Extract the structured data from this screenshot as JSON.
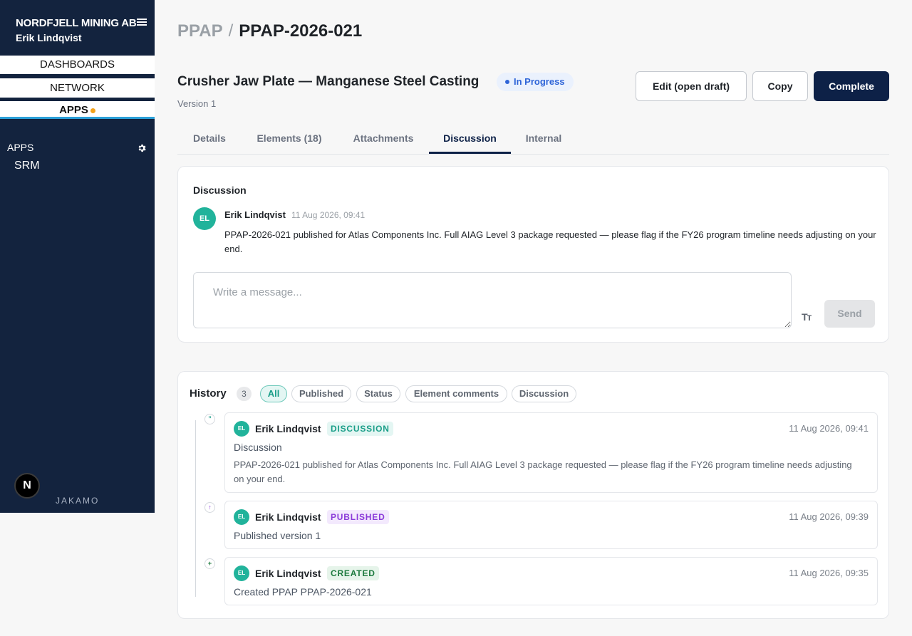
{
  "sidebar": {
    "org_name": "NORDFJELL MINING AB",
    "user_name": "Erik Lindqvist",
    "nav": {
      "dashboards": "DASHBOARDS",
      "network": "NETWORK",
      "apps": "APPS"
    },
    "apps_heading": "APPS",
    "apps_items": [
      "SRM"
    ],
    "badge_letter": "N",
    "brand": "JAKAMO"
  },
  "breadcrumb": {
    "root": "PPAP",
    "separator": "/",
    "current": "PPAP-2026-021"
  },
  "header": {
    "title": "Crusher Jaw Plate — Manganese Steel Casting",
    "status": "In Progress",
    "version": "Version 1",
    "buttons": {
      "edit": "Edit (open draft)",
      "copy": "Copy",
      "complete": "Complete"
    }
  },
  "tabs": [
    {
      "label": "Details"
    },
    {
      "label": "Elements (18)"
    },
    {
      "label": "Attachments"
    },
    {
      "label": "Discussion",
      "active": true
    },
    {
      "label": "Internal"
    }
  ],
  "discussion": {
    "title": "Discussion",
    "message": {
      "initials": "EL",
      "author": "Erik Lindqvist",
      "time": "11 Aug 2026, 09:41",
      "text": "PPAP-2026-021 published for Atlas Components Inc. Full AIAG Level 3 package requested — please flag if the FY26 program timeline needs adjusting on your end."
    },
    "input_placeholder": "Write a message...",
    "format_icon": "Tт",
    "send_label": "Send"
  },
  "history": {
    "title": "History",
    "count": "3",
    "filters": [
      "All",
      "Published",
      "Status",
      "Element comments",
      "Discussion"
    ],
    "active_filter": "All",
    "events": [
      {
        "icon": "quote-icon",
        "initials": "EL",
        "author": "Erik Lindqvist",
        "tag": "DISCUSSION",
        "time": "11 Aug 2026, 09:41",
        "subtitle": "Discussion",
        "body": "PPAP-2026-021 published for Atlas Components Inc. Full AIAG Level 3 package requested — please flag if the FY26 program timeline needs adjusting on your end."
      },
      {
        "icon": "arrow-up-icon",
        "initials": "EL",
        "author": "Erik Lindqvist",
        "tag": "PUBLISHED",
        "time": "11 Aug 2026, 09:39",
        "subtitle": "Published version 1"
      },
      {
        "icon": "plus-icon",
        "initials": "EL",
        "author": "Erik Lindqvist",
        "tag": "CREATED",
        "time": "11 Aug 2026, 09:35",
        "subtitle": "Created PPAP PPAP-2026-021"
      }
    ]
  },
  "colors": {
    "sidebar_bg": "#13233e",
    "primary": "#0d2147",
    "accent_teal": "#21b39b",
    "status_blue": "#2f65d8",
    "apps_dot": "#f3a21b"
  }
}
